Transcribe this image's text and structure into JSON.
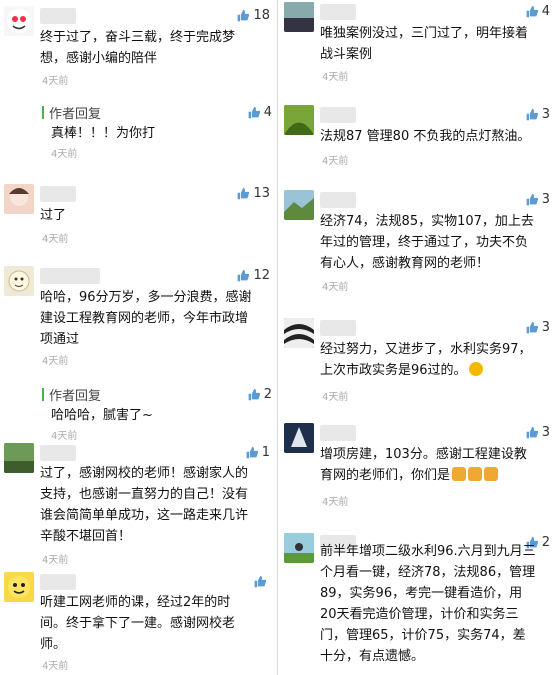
{
  "left": [
    {
      "likes": "18",
      "lines": "终于过了，奋斗三载，终于完成梦\n想，感谢小编的陪伴",
      "time": "4天前",
      "reply": {
        "tag": "作者回复",
        "likes": "4",
        "text": "真棒！！！为你打",
        "time": "4天前"
      }
    },
    {
      "likes": "13",
      "lines": "过了",
      "time": "4天前"
    },
    {
      "likes": "12",
      "lines": "哈哈，96分万岁，多一分浪费，感谢\n建设工程教育网的老师，今年市政增\n项通过",
      "time": "4天前",
      "reply": {
        "tag": "作者回复",
        "likes": "2",
        "text": "哈哈哈，腻害了~",
        "time": "4天前"
      }
    },
    {
      "likes": "1",
      "lines": "过了，感谢网校的老师！感谢家人的\n支持，也感谢一直努力的自己！没有\n谁会简简单单成功，这一路走来几许\n辛酸不堪回首！",
      "time": "4天前"
    },
    {
      "likes": "",
      "lines": "听建工网老师的课，经过2年的时\n间。终于拿下了一建。感谢网校老\n师。",
      "time": "4天前"
    }
  ],
  "right": [
    {
      "likes": "4",
      "lines": "唯独案例没过，三门过了，明年接着\n战斗案例",
      "time": "4天前"
    },
    {
      "likes": "3",
      "lines": "法规87 管理80 不负我的点灯熬油。",
      "time": "4天前"
    },
    {
      "likes": "3",
      "lines": "经济74，法规85，实物107，加上去\n年过的管理，终于通过了，功夫不负\n有心人，感谢教育网的老师！",
      "time": "4天前"
    },
    {
      "likes": "3",
      "lines": "经过努力，又进步了，水利实务97，\n上次市政实务是96过的。",
      "time": "4天前"
    },
    {
      "likes": "3",
      "lines": "增项房建，103分。感谢工程建设教\n育网的老师们，你们是",
      "time": "4天前"
    },
    {
      "likes": "2",
      "lines": "前半年增项二级水利96.六月到九月三\n个月看一键，经济78，法规86，管理\n89，实务96，考完一键看造价，用\n20天看完造价管理，计价和实务三\n门，管理65，计价75，实务74，差\n十分，有点遗憾。",
      "time": "4天前"
    }
  ]
}
